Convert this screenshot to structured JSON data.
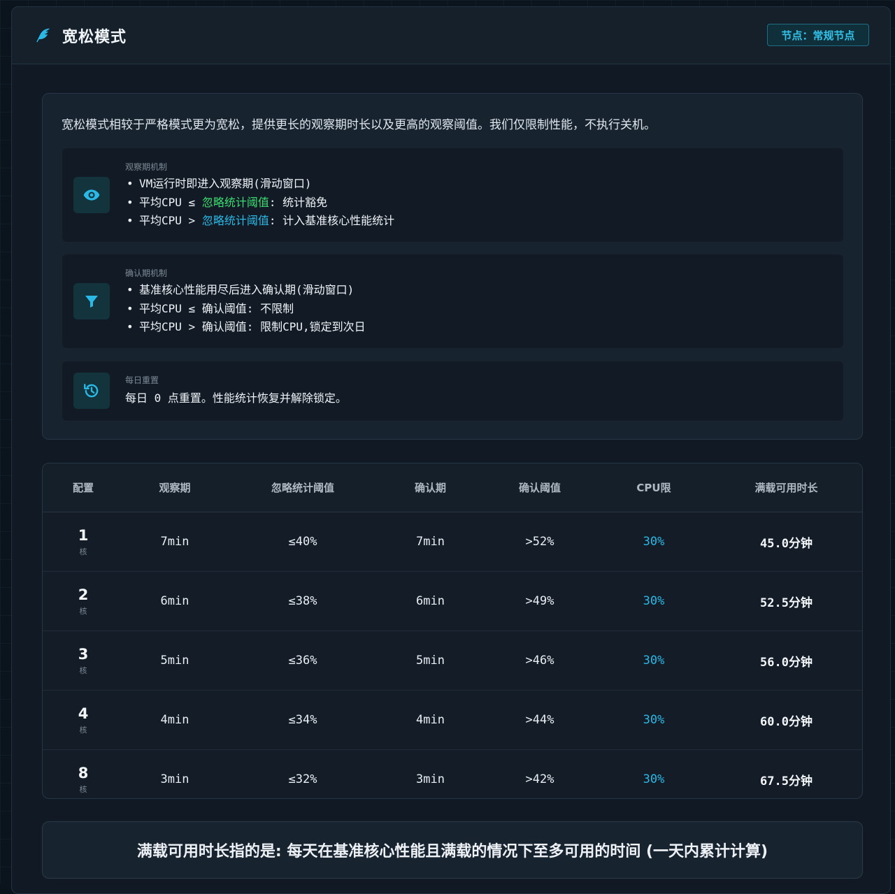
{
  "header": {
    "title": "宽松模式",
    "node_badge": "节点：常规节点"
  },
  "intro": "宽松模式相较于严格模式更为宽松，提供更长的观察期时长以及更高的观察阈值。我们仅限制性能，不执行关机。",
  "mechanisms": [
    {
      "label": "观察期机制",
      "icon": "eye-icon",
      "lines": [
        {
          "a": "VM运行时即进入观察期(滑动窗口)"
        },
        {
          "a": "平均CPU ≤ ",
          "h": "忽略统计阈值",
          "hc": "green",
          "b": ": 统计豁免"
        },
        {
          "a": "平均CPU > ",
          "h": "忽略统计阈值",
          "hc": "cyan",
          "b": ": 计入基准核心性能统计"
        }
      ]
    },
    {
      "label": "确认期机制",
      "icon": "filter-icon",
      "lines": [
        {
          "a": "基准核心性能用尽后进入确认期(滑动窗口)"
        },
        {
          "a": "平均CPU ≤ 确认阈值: 不限制"
        },
        {
          "a": "平均CPU > 确认阈值: 限制CPU,锁定到次日"
        }
      ]
    },
    {
      "label": "每日重置",
      "icon": "history-icon",
      "lines": [
        {
          "a": "每日 0 点重置。性能统计恢复并解除锁定。"
        }
      ]
    }
  ],
  "table": {
    "headers": [
      "配置",
      "观察期",
      "忽略统计阈值",
      "确认期",
      "确认阈值",
      "CPU限",
      "满载可用时长"
    ],
    "core_unit": "核",
    "rows": [
      {
        "cores": "1",
        "observe": "7min",
        "ignore": "≤40%",
        "confirm": "7min",
        "confirm_th": ">52%",
        "cpu": "30%",
        "duration": "45.0分钟"
      },
      {
        "cores": "2",
        "observe": "6min",
        "ignore": "≤38%",
        "confirm": "6min",
        "confirm_th": ">49%",
        "cpu": "30%",
        "duration": "52.5分钟"
      },
      {
        "cores": "3",
        "observe": "5min",
        "ignore": "≤36%",
        "confirm": "5min",
        "confirm_th": ">46%",
        "cpu": "30%",
        "duration": "56.0分钟"
      },
      {
        "cores": "4",
        "observe": "4min",
        "ignore": "≤34%",
        "confirm": "4min",
        "confirm_th": ">44%",
        "cpu": "30%",
        "duration": "60.0分钟"
      },
      {
        "cores": "8",
        "observe": "3min",
        "ignore": "≤32%",
        "confirm": "3min",
        "confirm_th": ">42%",
        "cpu": "30%",
        "duration": "67.5分钟"
      }
    ]
  },
  "footer_note": "满载可用时长指的是: 每天在基准核心性能且满载的情况下至多可用的时间 (一天内累计计算)",
  "colors": {
    "accent_cyan": "#2ab9e6",
    "accent_green": "#3ddc71",
    "panel_bg": "#111a24"
  }
}
